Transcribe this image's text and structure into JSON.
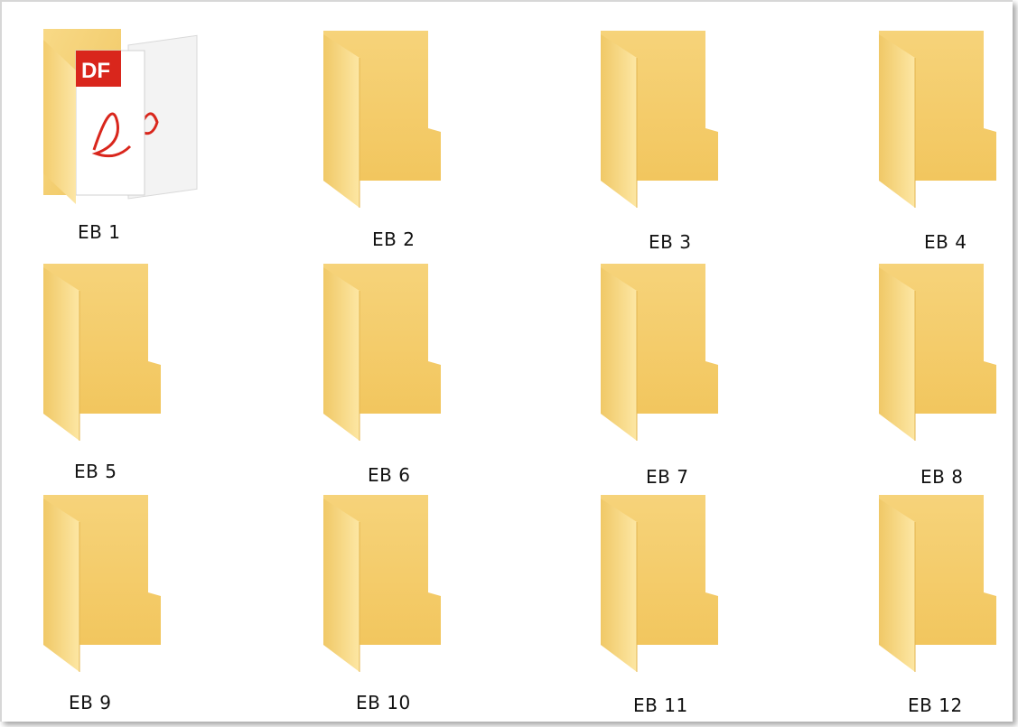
{
  "folders": [
    {
      "label": "EB 1",
      "icon": "pdf-folder-icon"
    },
    {
      "label": "EB 2",
      "icon": "folder-icon"
    },
    {
      "label": "EB 3",
      "icon": "folder-icon"
    },
    {
      "label": "EB 4",
      "icon": "folder-icon"
    },
    {
      "label": "EB 5",
      "icon": "folder-icon"
    },
    {
      "label": "EB 6",
      "icon": "folder-icon"
    },
    {
      "label": "EB 7",
      "icon": "folder-icon"
    },
    {
      "label": "EB 8",
      "icon": "folder-icon"
    },
    {
      "label": "EB 9",
      "icon": "folder-icon"
    },
    {
      "label": "EB 10",
      "icon": "folder-icon"
    },
    {
      "label": "EB 11",
      "icon": "folder-icon"
    },
    {
      "label": "EB 12",
      "icon": "folder-icon"
    }
  ],
  "pdf_badge_text": "DF",
  "colors": {
    "folder_back": "#f6d37a",
    "folder_front": "#fbe29b",
    "folder_edge": "#e9bd55",
    "pdf_red": "#d9261c"
  }
}
